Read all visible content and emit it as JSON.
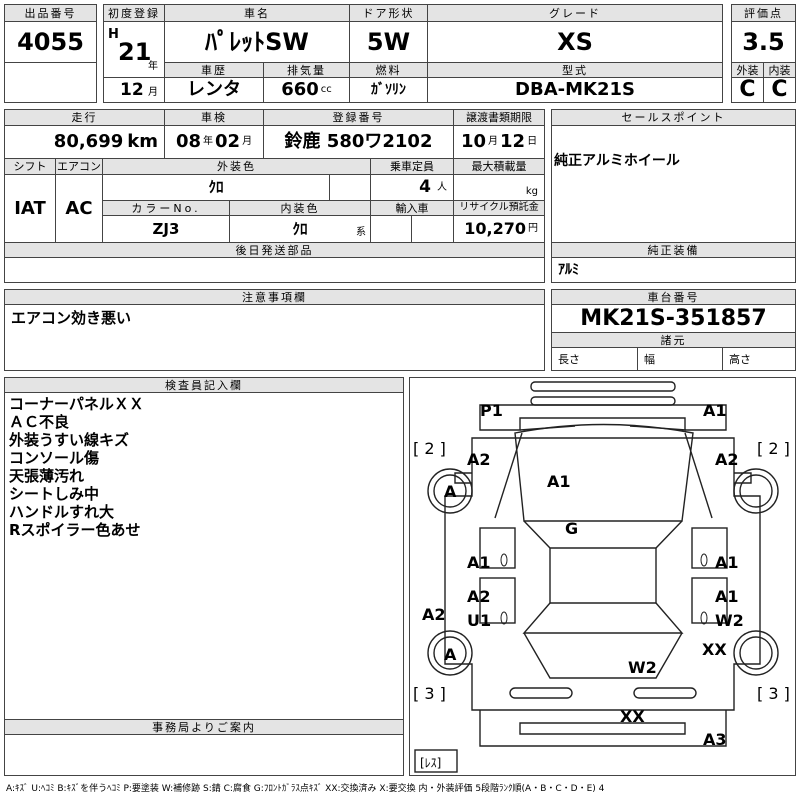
{
  "header": {
    "lot_label": "出品番号",
    "lot_value": "4055",
    "first_reg_label": "初度登録",
    "era_mark": "H",
    "reg_year": "21",
    "year_unit": "年",
    "reg_month": "12",
    "month_unit": "月",
    "car_name_label": "車名",
    "car_name": "ﾊﾟﾚｯﾄSW",
    "door_label": "ドア形状",
    "door_value": "5W",
    "grade_label": "グレード",
    "grade_value": "XS",
    "score_label": "評価点",
    "score_value": "3.5",
    "history_label": "車歴",
    "history_value": "レンタ",
    "displacement_label": "排気量",
    "displacement_value": "660",
    "displacement_unit": "cc",
    "fuel_label": "燃料",
    "fuel_value": "ｶﾞｿﾘﾝ",
    "model_label": "型式",
    "model_value": "DBA-MK21S",
    "ext_label": "外装",
    "ext_value": "C",
    "int_label": "内装",
    "int_value": "C"
  },
  "row2": {
    "mileage_label": "走行",
    "mileage_value": "80,699",
    "mileage_unit": "km",
    "inspection_label": "車検",
    "insp_year": "08",
    "year_unit": "年",
    "insp_month": "02",
    "month_unit": "月",
    "plate_label": "登録番号",
    "plate_value": "鈴鹿 580ワ2102",
    "transfer_label": "譲渡書類期限",
    "transfer_month": "10",
    "transfer_day": "12",
    "day_unit": "日",
    "sales_label": "セールスポイント",
    "sales_value": "純正アルミホイール",
    "shift_label": "シフト",
    "shift_value": "IAT",
    "ac_label": "エアコン",
    "ac_value": "AC",
    "color_label": "外装色",
    "color_value": "ｸﾛ",
    "capacity_label": "乗車定員",
    "capacity_value": "4",
    "capacity_unit": "人",
    "load_label": "最大積載量",
    "load_unit": "kg",
    "color_no_label": "カラーNo.",
    "color_no_value": "ZJ3",
    "interior_color_label": "内装色",
    "interior_color_value": "ｸﾛ",
    "interior_color_unit": "系",
    "import_label": "輸入車",
    "recycle_label": "リサイクル預託金",
    "recycle_value": "10,270",
    "recycle_unit": "円",
    "later_parts_label": "後日発送部品",
    "genuine_label": "純正装備",
    "genuine_value": "ｱﾙﾐ"
  },
  "notes": {
    "caution_label": "注意事項欄",
    "caution_value": "エアコン効き悪い",
    "chassis_label": "車台番号",
    "chassis_value": "MK21S-351857",
    "specs_label": "諸元",
    "length_label": "長さ",
    "width_label": "幅",
    "height_label": "高さ"
  },
  "inspector": {
    "label": "検査員記入欄",
    "lines": [
      "コーナーパネルＸＸ",
      "ＡＣ不良",
      "外装うすい線キズ",
      "コンソール傷",
      "天張薄汚れ",
      "シートしみ中",
      "ハンドルすれ大",
      "Rスポイラー色あせ"
    ]
  },
  "office": {
    "label": "事務局よりご案内"
  },
  "diagram": {
    "marks": {
      "p1": "P1",
      "a1_front": "A1",
      "bracket_fl": "[ 2 ]",
      "bracket_fr": "[ 2 ]",
      "a2_fl": "A2",
      "a2_fr": "A2",
      "wheel_fl": "A",
      "a1_hood": "A1",
      "g_glass": "G",
      "a1_left": "A1",
      "a1_right": "A1",
      "a2_left": "A2",
      "u1_left": "U1",
      "a1_right2": "A1",
      "w2_right": "W2",
      "a2_side": "A2",
      "wheel_rl": "A",
      "xx_rr": "XX",
      "w2_rear": "W2",
      "bracket_rl": "[ 3 ]",
      "bracket_rr": "[ 3 ]",
      "xx_bumper": "XX",
      "a3_rear": "A3",
      "less": "[ﾚｽ]"
    }
  },
  "legend": "A:ｷｽﾞ U:ﾍｺﾐ B:ｷｽﾞを伴うﾍｺﾐ P:要塗装 W:補修跡 S:錆 C:腐食 G:ﾌﾛﾝﾄｶﾞﾗｽ点ｷｽﾞ XX:交換済み X:要交換 内・外装評価 5段階ﾗﾝｸ順(A・B・C・D・E) 4"
}
